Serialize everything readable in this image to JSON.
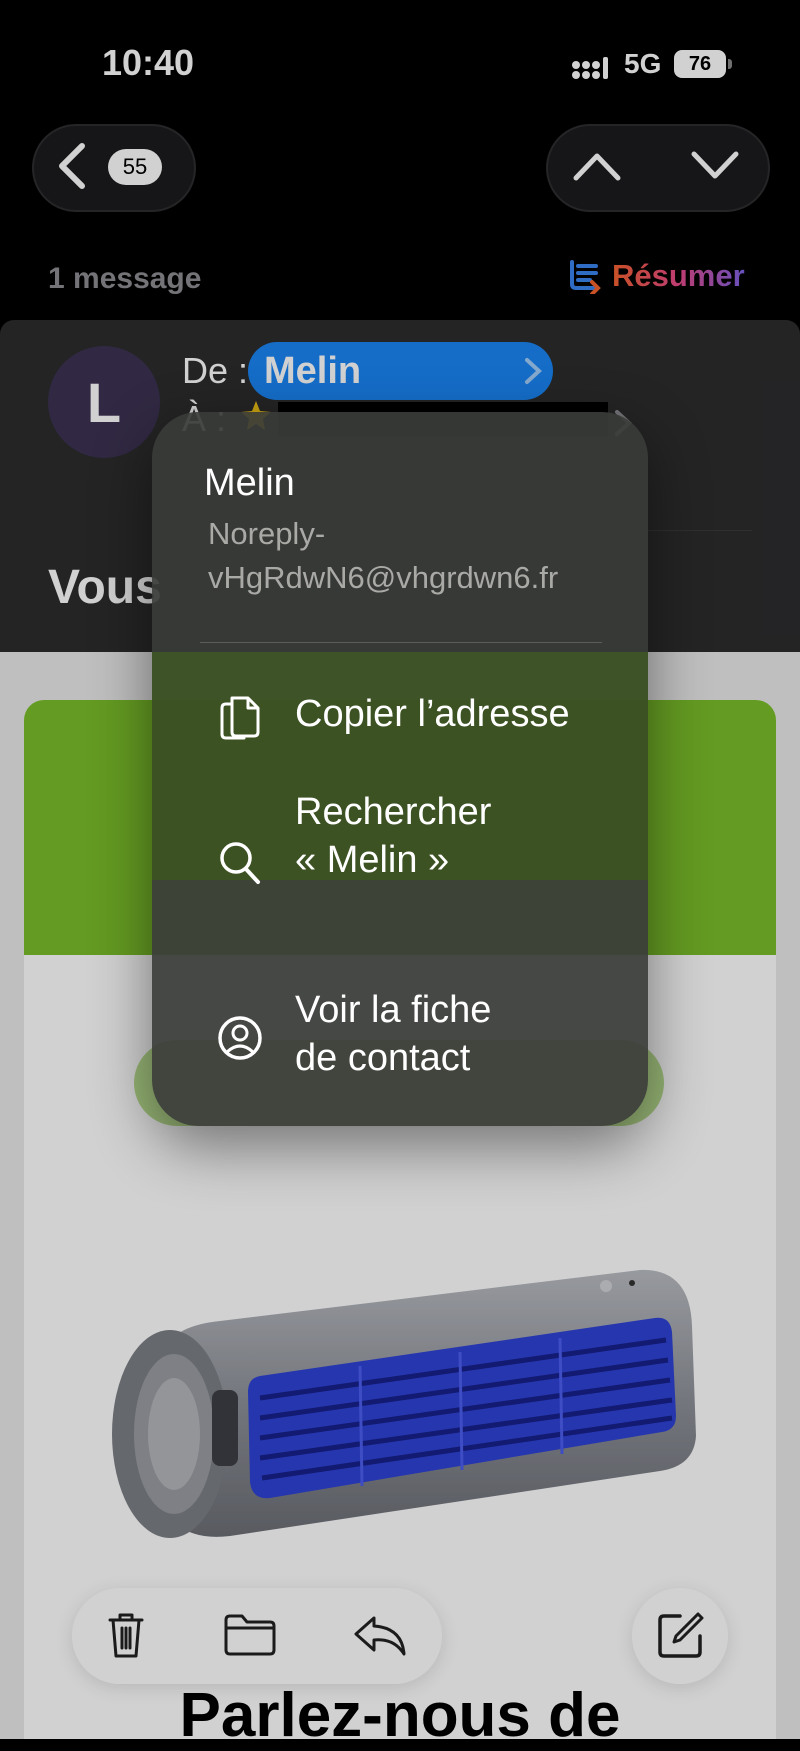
{
  "status_bar": {
    "time": "10:40",
    "network": "5G",
    "battery": "76"
  },
  "nav": {
    "unread_count": "55"
  },
  "thread": {
    "message_count": "1 message",
    "summarize_label": "Résumer"
  },
  "header": {
    "from_label": "De :",
    "sender_name": "Melin",
    "to_label": "À :",
    "subject_partial": "Vous"
  },
  "email_body": {
    "headline_partial": "Parlez-nous de"
  },
  "popover": {
    "name": "Melin",
    "email": "Noreply-vHgRdwN6@vhgrdwn6.fr",
    "copy_label": "Copier l’adresse",
    "search_label_line1": "Rechercher",
    "search_label_line2": "« Melin »",
    "contact_label_line1": "Voir la fiche",
    "contact_label_line2": "de contact"
  },
  "colors": {
    "accent_blue": "#1a86f5",
    "banner_green": "#7bbe2a",
    "product_blue": "#2f43d6"
  },
  "icons": [
    "back-chevron-icon",
    "up-arrow-icon",
    "down-arrow-icon",
    "summarize-icon",
    "star-icon",
    "copy-icon",
    "search-icon",
    "contact-icon",
    "trash-icon",
    "folder-icon",
    "reply-icon",
    "compose-icon"
  ]
}
